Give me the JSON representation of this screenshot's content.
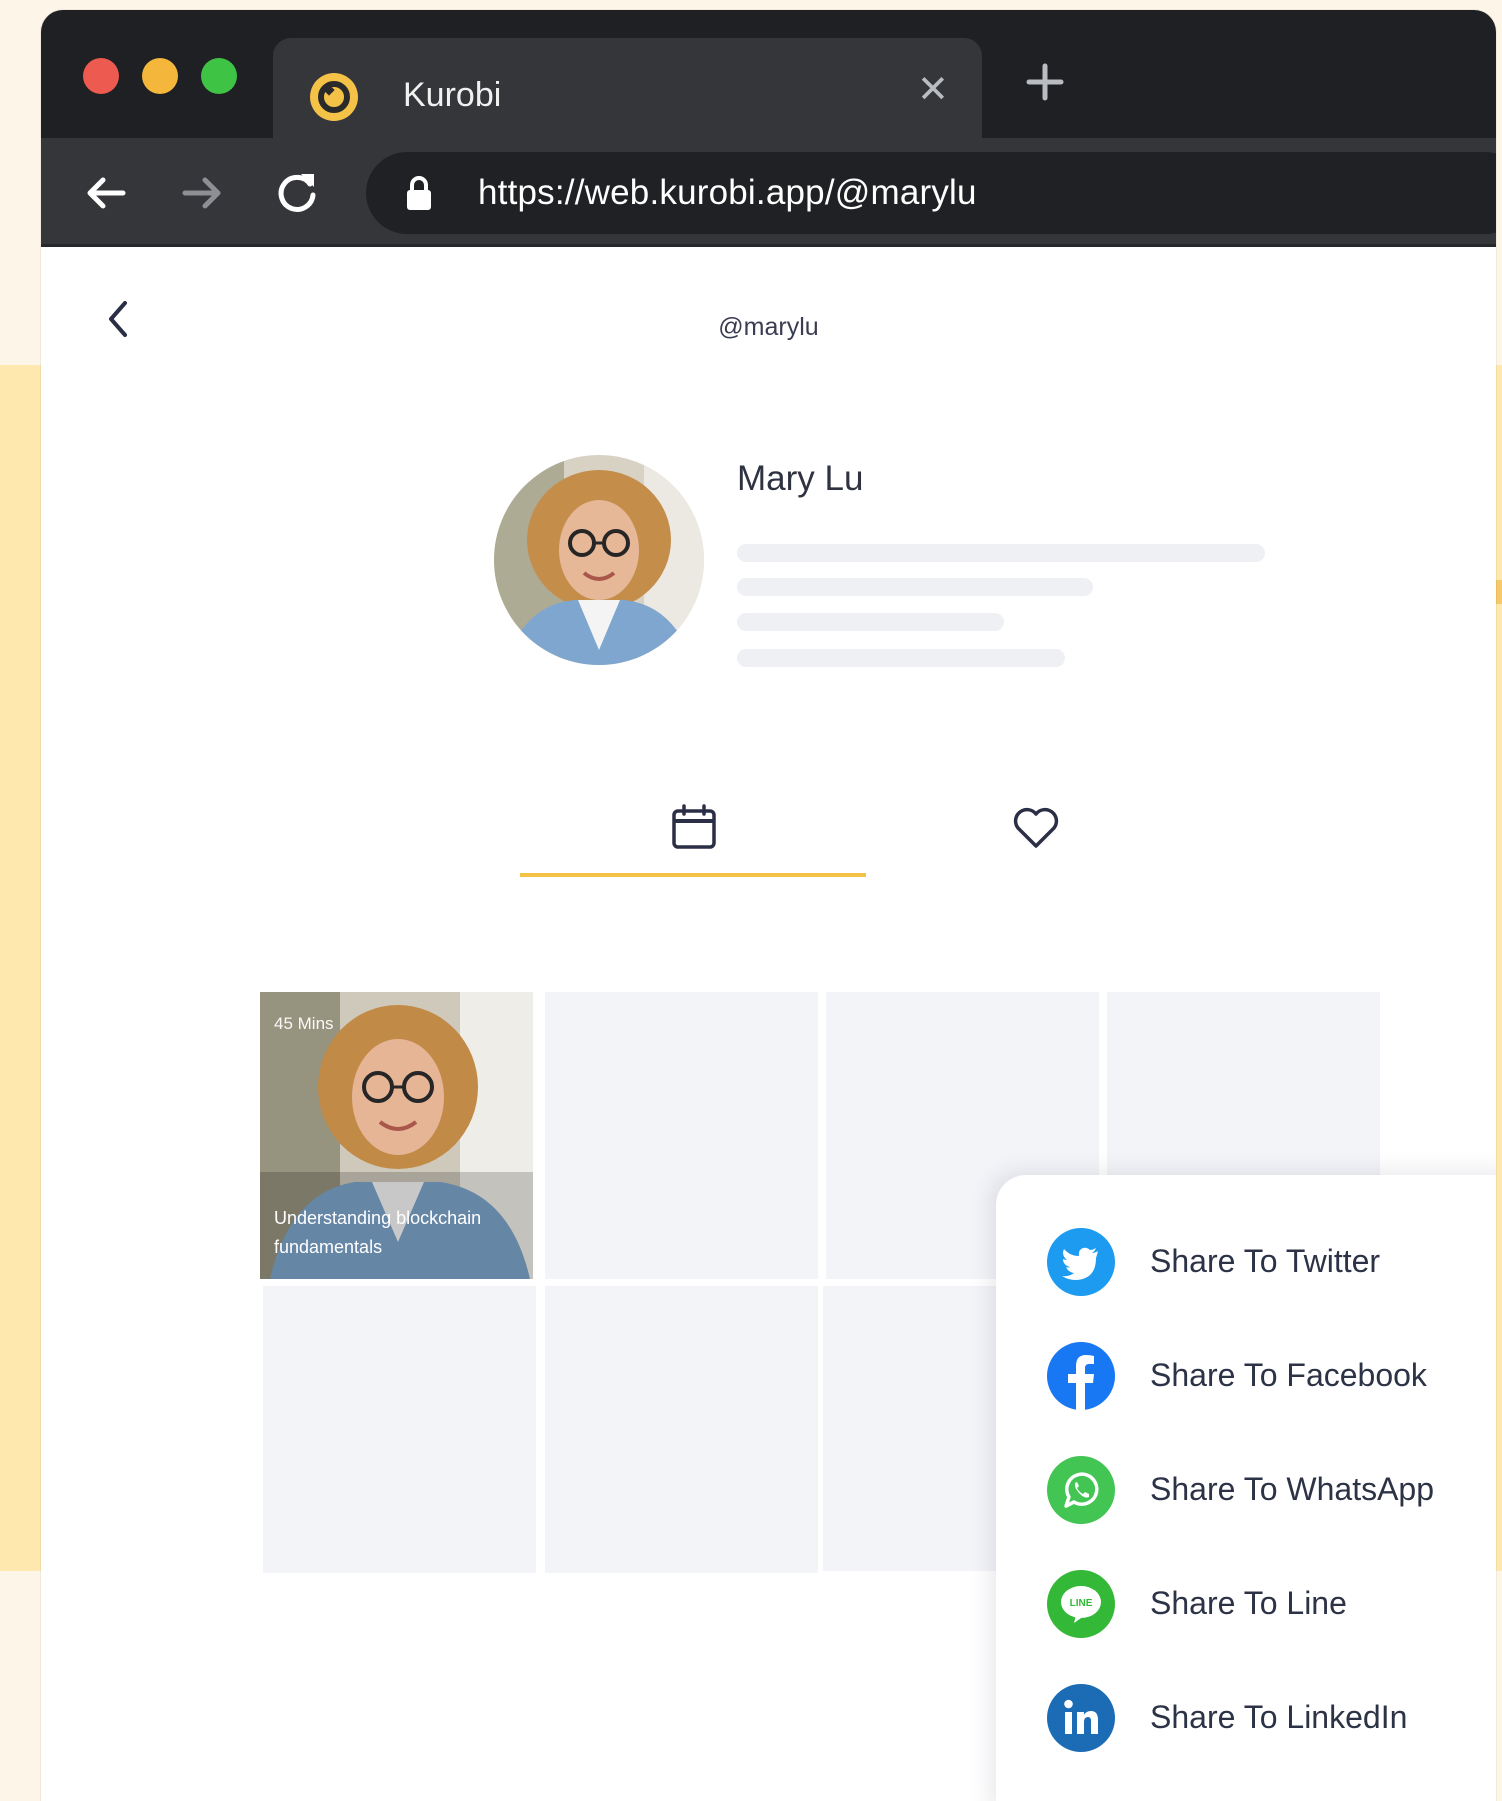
{
  "browser": {
    "tab_title": "Kurobi",
    "url": "https://web.kurobi.app/@marylu"
  },
  "page": {
    "handle": "@marylu",
    "display_name": "Mary Lu"
  },
  "grid": {
    "featured": {
      "duration": "45 Mins",
      "title": "Understanding blockchain fundamentals"
    }
  },
  "share_menu": {
    "items": [
      {
        "label": "Share To Twitter",
        "icon": "twitter-icon",
        "color": "#1d9bf0"
      },
      {
        "label": "Share To Facebook",
        "icon": "facebook-icon",
        "color": "#1877f2"
      },
      {
        "label": "Share To WhatsApp",
        "icon": "whatsapp-icon",
        "color": "#43c553"
      },
      {
        "label": "Share To Line",
        "icon": "line-icon",
        "color": "#34b838"
      },
      {
        "label": "Share To LinkedIn",
        "icon": "linkedin-icon",
        "color": "#1b6cb5"
      }
    ]
  },
  "colors": {
    "accent": "#f5c248",
    "browser_dark": "#1f2023",
    "browser_tab": "#35363a",
    "background": "#fee8ad"
  }
}
